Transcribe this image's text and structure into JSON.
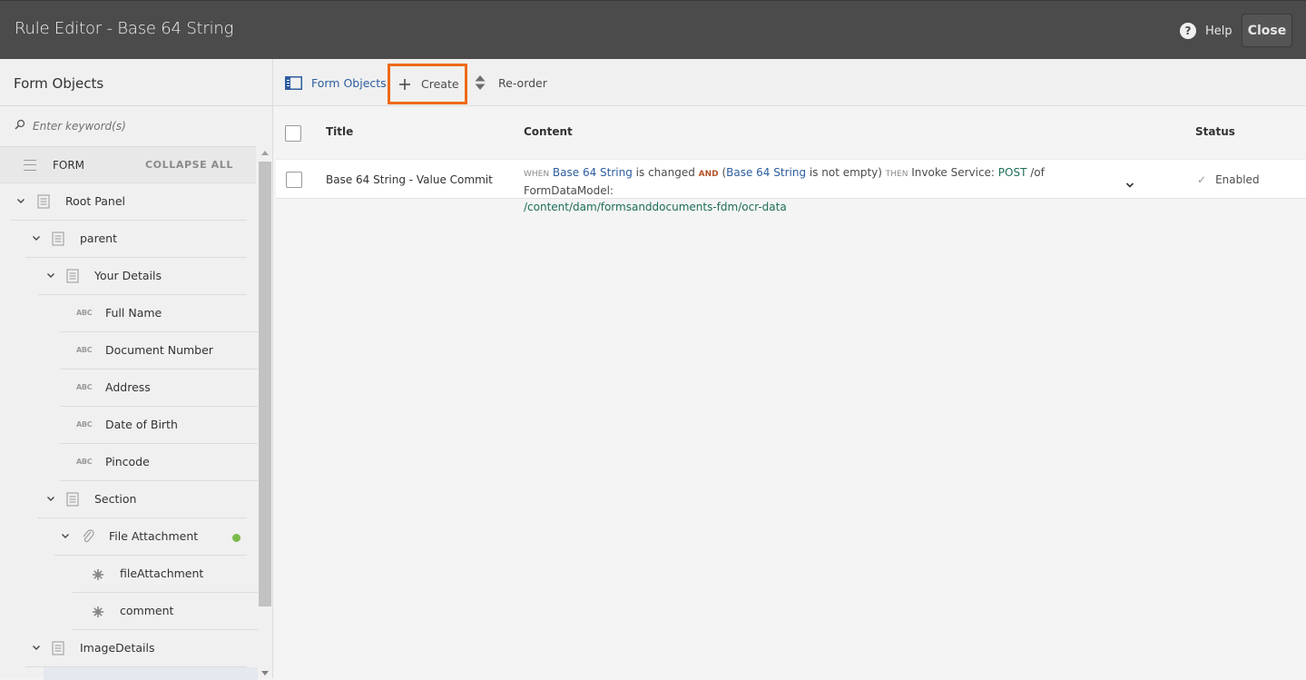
{
  "header": {
    "title": "Rule Editor - Base 64 String",
    "help_label": "Help",
    "close_label": "Close"
  },
  "left_panel": {
    "title": "Form Objects",
    "search_placeholder": "Enter keyword(s)",
    "form_label": "FORM",
    "collapse_all_label": "COLLAPSE ALL",
    "tree": [
      {
        "label": "Root Panel",
        "type": "panel",
        "level": 0,
        "expanded": true
      },
      {
        "label": "parent",
        "type": "panel",
        "level": 1,
        "expanded": true
      },
      {
        "label": "Your Details",
        "type": "panel",
        "level": 2,
        "expanded": true
      },
      {
        "label": "Full Name",
        "type": "text",
        "level": 3
      },
      {
        "label": "Document Number",
        "type": "text",
        "level": 3
      },
      {
        "label": "Address",
        "type": "text",
        "level": 3
      },
      {
        "label": "Date of Birth",
        "type": "text",
        "level": 3
      },
      {
        "label": "Pincode",
        "type": "text",
        "level": 3
      },
      {
        "label": "Section",
        "type": "panel",
        "level": 2,
        "expanded": true
      },
      {
        "label": "File Attachment",
        "type": "attachment",
        "level": 3,
        "expanded": true,
        "has_rule": true
      },
      {
        "label": "fileAttachment",
        "type": "star",
        "level": 4
      },
      {
        "label": "comment",
        "type": "star",
        "level": 4
      },
      {
        "label": "ImageDetails",
        "type": "panel",
        "level": 1,
        "expanded": true
      }
    ],
    "text_icon_label": "ABC"
  },
  "toolbar": {
    "form_objects_label": "Form Objects",
    "create_label": "Create",
    "reorder_label": "Re-order"
  },
  "table": {
    "columns": {
      "title": "Title",
      "content": "Content",
      "status": "Status"
    },
    "rows": [
      {
        "title": "Base 64 String - Value Commit",
        "content": {
          "when": "WHEN",
          "var1": "Base 64 String",
          "changed": " is changed ",
          "and": "AND",
          "open": " (",
          "var2": "Base 64 String",
          "not_empty": " is not empty) ",
          "then": "THEN",
          "invoke": " Invoke Service: ",
          "method": "POST",
          "of": " /of FormDataModel:",
          "path": "/content/dam/formsanddocuments-fdm/ocr-data"
        },
        "status": "Enabled"
      }
    ]
  },
  "colors": {
    "header_bg": "#4b4b4b",
    "accent_link": "#2d5d9f",
    "highlight_border": "#ee6a19",
    "rule_dot": "#7bbb4b"
  }
}
